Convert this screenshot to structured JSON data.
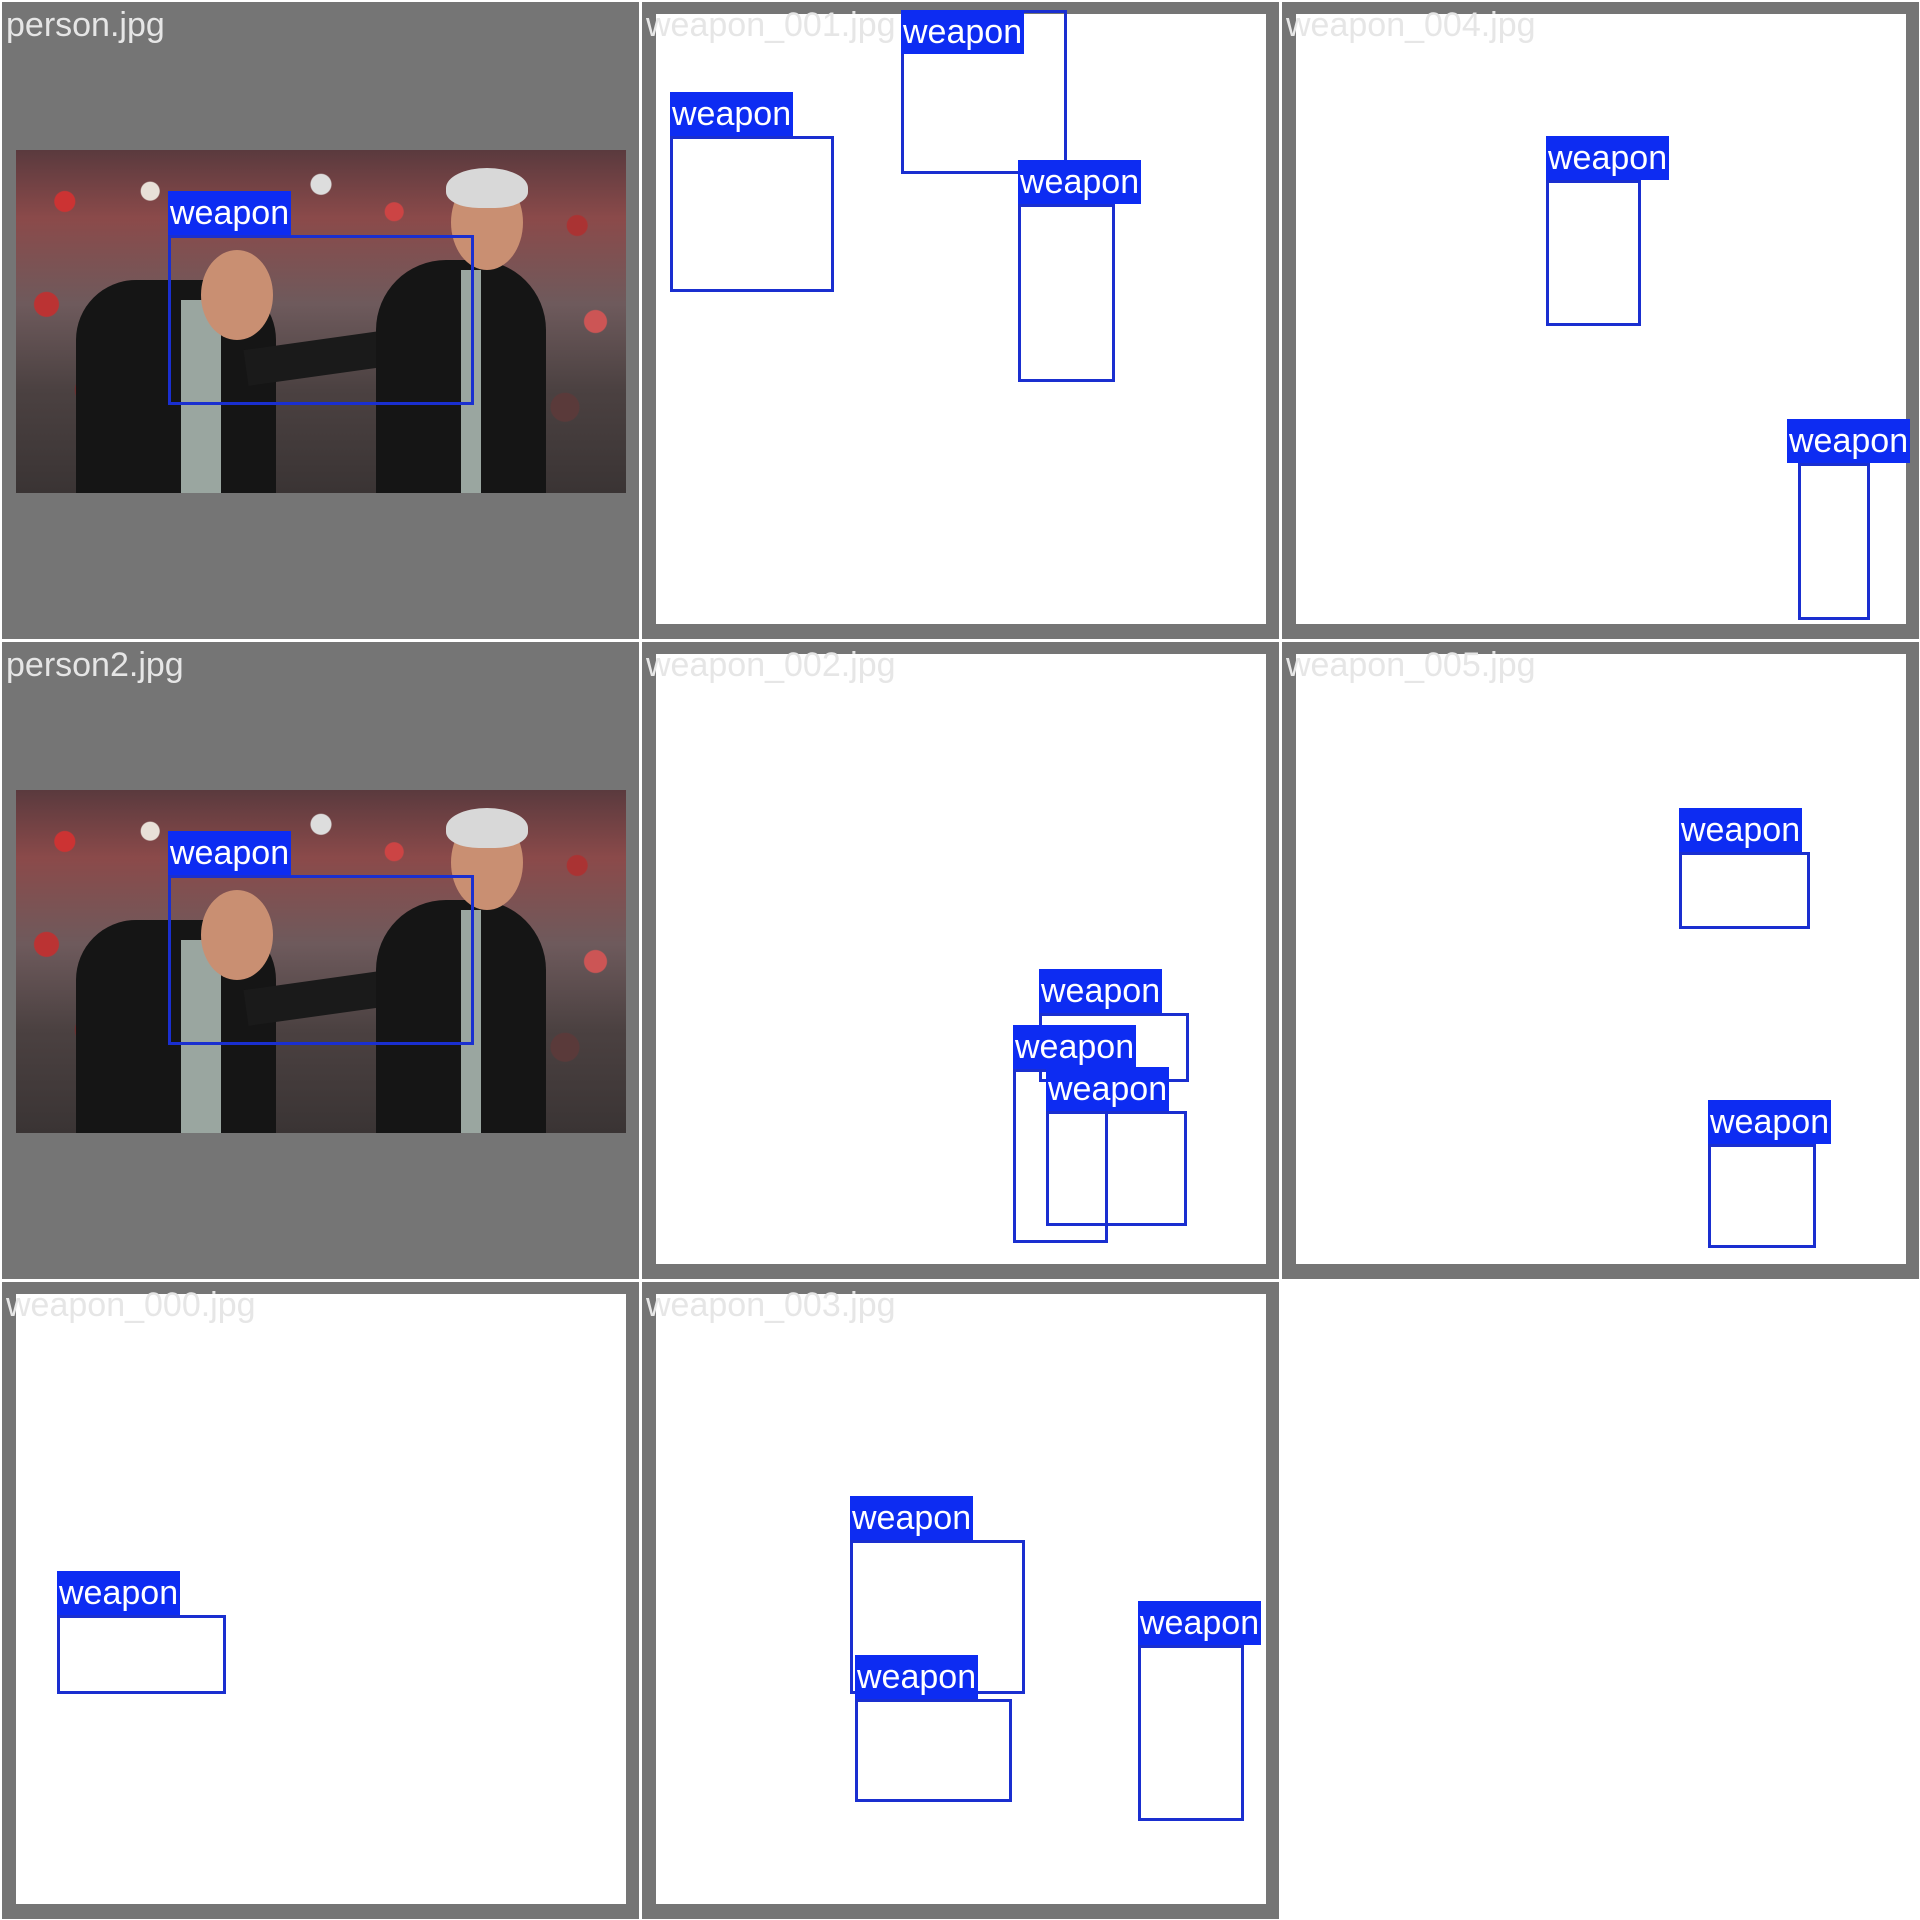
{
  "colors": {
    "tile_background": "#757575",
    "canvas": "#ffffff",
    "box_stroke": "#1a2fd0",
    "label_background": "#0d2cf2",
    "label_text": "#ffffff",
    "filename_text": "#e6e6e6"
  },
  "tiles": [
    {
      "filename": "person.jpg",
      "kind": "photo",
      "labels": [
        "weapon"
      ]
    },
    {
      "filename": "weapon_001.jpg",
      "kind": "blank",
      "labels": [
        "weapon",
        "weapon",
        "weapon"
      ]
    },
    {
      "filename": "weapon_004.jpg",
      "kind": "blank",
      "labels": [
        "weapon",
        "weapon"
      ]
    },
    {
      "filename": "person2.jpg",
      "kind": "photo",
      "labels": [
        "weapon"
      ]
    },
    {
      "filename": "weapon_002.jpg",
      "kind": "blank",
      "labels": [
        "weapon",
        "weapon",
        "weapon"
      ]
    },
    {
      "filename": "weapon_005.jpg",
      "kind": "blank",
      "labels": [
        "weapon",
        "weapon"
      ]
    },
    {
      "filename": "weapon_000.jpg",
      "kind": "blank",
      "labels": [
        "weapon"
      ]
    },
    {
      "filename": "weapon_003.jpg",
      "kind": "blank",
      "labels": [
        "weapon",
        "weapon",
        "weapon"
      ]
    }
  ]
}
